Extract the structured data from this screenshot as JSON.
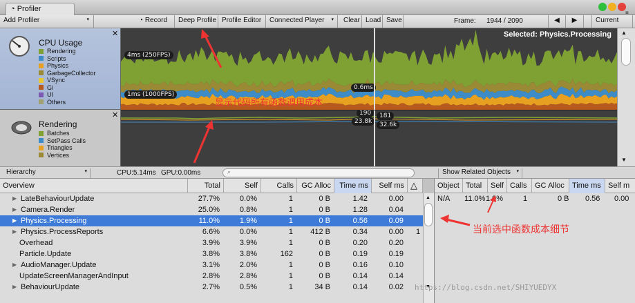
{
  "window": {
    "tab_title": "Profiler"
  },
  "toolbar": {
    "add_profiler": "Add Profiler",
    "record": "Record",
    "deep_profile": "Deep Profile",
    "profile_editor": "Profile Editor",
    "connected_player": "Connected Player",
    "clear": "Clear",
    "load": "Load",
    "save": "Save",
    "frame_label": "Frame:",
    "frame_value": "1944 / 2090",
    "current": "Current"
  },
  "cpu_pane": {
    "title": "CPU Usage",
    "legend": [
      {
        "label": "Rendering",
        "color": "#7fa133"
      },
      {
        "label": "Scripts",
        "color": "#3d8cc8"
      },
      {
        "label": "Physics",
        "color": "#e8a020"
      },
      {
        "label": "GarbageCollector",
        "color": "#9a8a35"
      },
      {
        "label": "VSync",
        "color": "#e8c830"
      },
      {
        "label": "Gi",
        "color": "#b85a1e"
      },
      {
        "label": "UI",
        "color": "#7a5ab0"
      },
      {
        "label": "Others",
        "color": "#a0a070"
      }
    ],
    "selected": "Selected: Physics.Processing",
    "marker_4ms": "4ms (250FPS)",
    "marker_1ms": "1ms (1000FPS)",
    "value_pill": "0.6ms"
  },
  "render_pane": {
    "title": "Rendering",
    "legend": [
      {
        "label": "Batches",
        "color": "#7fa133"
      },
      {
        "label": "SetPass Calls",
        "color": "#3d8cc8"
      },
      {
        "label": "Triangles",
        "color": "#e8a020"
      },
      {
        "label": "Vertices",
        "color": "#9a8a35"
      }
    ],
    "pill_190": "190",
    "pill_181": "181",
    "pill_238": "23.8k",
    "pill_326": "32.6k"
  },
  "hierarchy_bar": {
    "mode": "Hierarchy",
    "cpu": "CPU:5.14ms",
    "gpu": "GPU:0.00ms",
    "related": "Show Related Objects"
  },
  "table": {
    "headers": [
      "Overview",
      "Total",
      "Self",
      "Calls",
      "GC Alloc",
      "Time ms",
      "Self ms"
    ],
    "rows": [
      {
        "name": "LateBehaviourUpdate",
        "total": "27.7%",
        "self": "0.0%",
        "calls": "1",
        "gc": "0 B",
        "time": "1.42",
        "selfms": "0.00",
        "arrow": true,
        "extra": ""
      },
      {
        "name": "Camera.Render",
        "total": "25.0%",
        "self": "0.8%",
        "calls": "1",
        "gc": "0 B",
        "time": "1.28",
        "selfms": "0.04",
        "arrow": true,
        "extra": ""
      },
      {
        "name": "Physics.Processing",
        "total": "11.0%",
        "self": "1.9%",
        "calls": "1",
        "gc": "0 B",
        "time": "0.56",
        "selfms": "0.09",
        "arrow": true,
        "extra": "",
        "selected": true
      },
      {
        "name": "Physics.ProcessReports",
        "total": "6.6%",
        "self": "0.0%",
        "calls": "1",
        "gc": "412 B",
        "time": "0.34",
        "selfms": "0.00",
        "arrow": true,
        "extra": "1"
      },
      {
        "name": "Overhead",
        "total": "3.9%",
        "self": "3.9%",
        "calls": "1",
        "gc": "0 B",
        "time": "0.20",
        "selfms": "0.20",
        "arrow": false,
        "extra": ""
      },
      {
        "name": "Particle.Update",
        "total": "3.8%",
        "self": "3.8%",
        "calls": "162",
        "gc": "0 B",
        "time": "0.19",
        "selfms": "0.19",
        "arrow": false,
        "extra": ""
      },
      {
        "name": "AudioManager.Update",
        "total": "3.1%",
        "self": "2.0%",
        "calls": "1",
        "gc": "0 B",
        "time": "0.16",
        "selfms": "0.10",
        "arrow": true,
        "extra": ""
      },
      {
        "name": "UpdateScreenManagerAndInput",
        "total": "2.8%",
        "self": "2.8%",
        "calls": "1",
        "gc": "0 B",
        "time": "0.14",
        "selfms": "0.14",
        "arrow": false,
        "extra": ""
      },
      {
        "name": "BehaviourUpdate",
        "total": "2.7%",
        "self": "0.5%",
        "calls": "1",
        "gc": "34 B",
        "time": "0.14",
        "selfms": "0.02",
        "arrow": true,
        "extra": ""
      }
    ]
  },
  "details": {
    "headers": [
      "Object",
      "Total",
      "Self",
      "Calls",
      "GC Alloc",
      "Time ms",
      "Self m"
    ],
    "row": {
      "object": "N/A",
      "total": "11.0%",
      "self": "1.9%",
      "calls": "1",
      "gc": "0 B",
      "time": "0.56",
      "selfms": "0.00"
    }
  },
  "annotations": {
    "code_cost": "显示代码所有函数调用成本",
    "selected_detail": "当前选中函数成本细节",
    "watermark": "https://blog.csdn.net/SHIYUEDYX"
  }
}
